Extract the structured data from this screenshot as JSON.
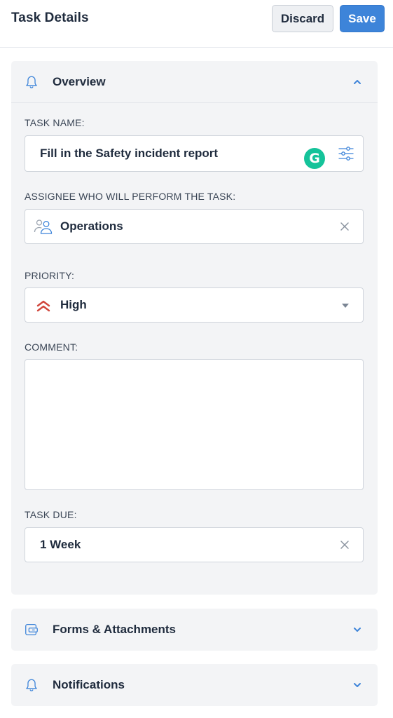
{
  "header": {
    "title": "Task Details",
    "discard_label": "Discard",
    "save_label": "Save"
  },
  "overview": {
    "title": "Overview",
    "icon": "bell-icon",
    "expanded": true,
    "task_name": {
      "label": "TASK NAME:",
      "value": "Fill in the Safety incident report",
      "grammarly_letter": "G"
    },
    "assignee": {
      "label": "ASSIGNEE WHO WILL PERFORM THE TASK:",
      "value": "Operations",
      "icon": "group-icon"
    },
    "priority": {
      "label": "PRIORITY:",
      "value": "High",
      "icon": "double-chevron-up-icon",
      "color": "#d1453b"
    },
    "comment": {
      "label": "COMMENT:",
      "value": ""
    },
    "task_due": {
      "label": "TASK DUE:",
      "value": "1 Week"
    }
  },
  "forms_panel": {
    "title": "Forms & Attachments",
    "icon": "attachment-icon",
    "expanded": false
  },
  "notifications_panel": {
    "title": "Notifications",
    "icon": "bell-icon",
    "expanded": false
  },
  "colors": {
    "accent": "#3d84d9",
    "panel_bg": "#f3f4f6",
    "grammarly": "#15c39a"
  }
}
